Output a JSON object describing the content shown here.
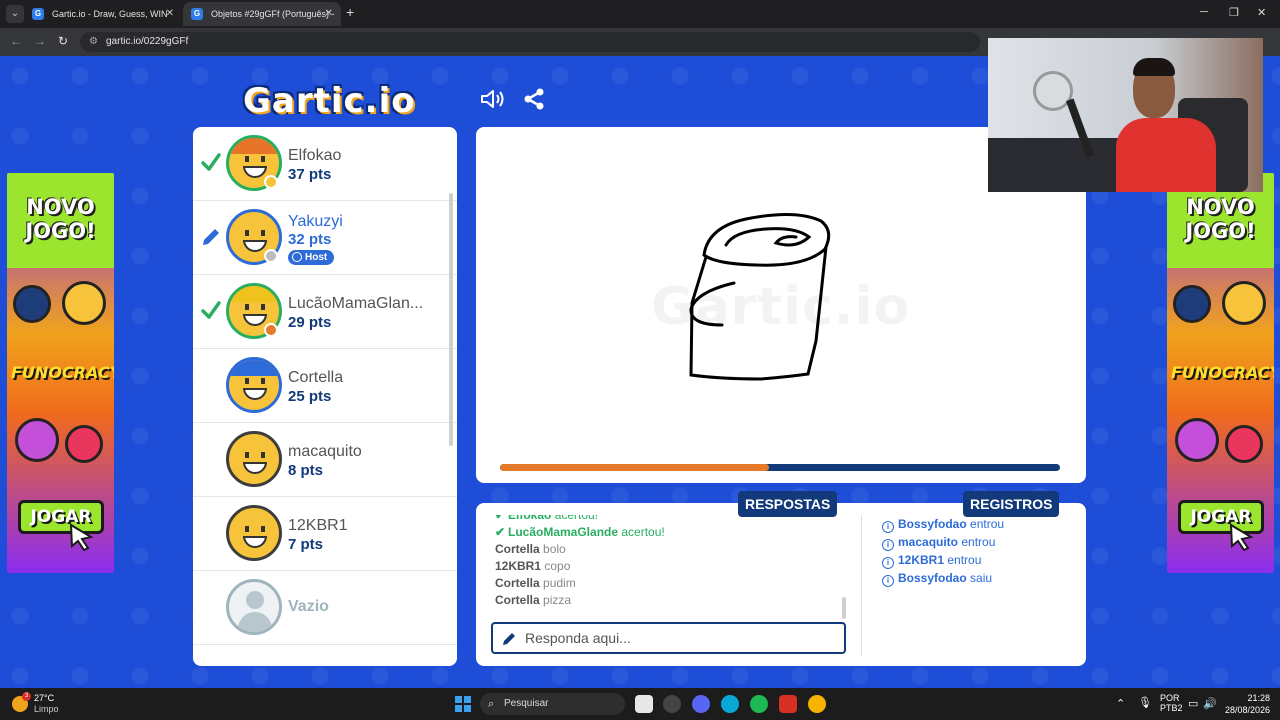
{
  "browser": {
    "tabs": [
      {
        "title": "Gartic.io - Draw, Guess, WIN",
        "favicon": "G"
      },
      {
        "title": "Objetos #29gGFf (Português) -",
        "favicon": "G"
      }
    ],
    "url": "gartic.io/0229gGFf"
  },
  "game": {
    "logo": "Gartic.io",
    "watermark": "Gartic.io",
    "progress": 0.48,
    "players": [
      {
        "name": "Elfokao",
        "points": "37 pts",
        "status": "guessed",
        "dot_color": "#f6c33b",
        "hair_color": "#e8742a",
        "ring": "green"
      },
      {
        "name": "Yakuzyi",
        "points": "32 pts",
        "status": "drawing",
        "host_label": "Host",
        "dot_color": "#bdbdbd",
        "hair_color": "",
        "ring": "blue"
      },
      {
        "name": "LucãoMamaGlan...",
        "points": "29 pts",
        "status": "guessed",
        "dot_color": "#e57a2a",
        "hair_color": "#f0c21c",
        "ring": "green"
      },
      {
        "name": "Cortella",
        "points": "25 pts",
        "status": "none",
        "dot_color": "",
        "hair_color": "#2d6bd8",
        "ring": "blue"
      },
      {
        "name": "macaquito",
        "points": "8 pts",
        "status": "none",
        "dot_color": "",
        "hair_color": "",
        "ring": "dark"
      },
      {
        "name": "12KBR1",
        "points": "7 pts",
        "status": "none",
        "dot_color": "",
        "hair_color": "",
        "ring": "dark"
      },
      {
        "name": "Vazio",
        "points": "",
        "status": "empty",
        "dot_color": "",
        "hair_color": "",
        "ring": "empty"
      }
    ],
    "answers_title": "RESPOSTAS",
    "logs_title": "REGISTROS",
    "answers": [
      {
        "who": "Elfokao",
        "what": "acertou!",
        "hit": true
      },
      {
        "who": "LucãoMamaGlande",
        "what": "acertou!",
        "hit": true
      },
      {
        "who": "Cortella",
        "what": "bolo",
        "hit": false
      },
      {
        "who": "12KBR1",
        "what": "copo",
        "hit": false
      },
      {
        "who": "Cortella",
        "what": "pudim",
        "hit": false
      },
      {
        "who": "Cortella",
        "what": "pizza",
        "hit": false
      }
    ],
    "answer_placeholder": "Responda aqui...",
    "logs": [
      {
        "who": "Bossyfodao",
        "what": "entrou"
      },
      {
        "who": "macaquito",
        "what": "entrou"
      },
      {
        "who": "12KBR1",
        "what": "entrou"
      },
      {
        "who": "Bossyfodao",
        "what": "saiu"
      }
    ]
  },
  "ads": {
    "title_line1": "NOVO",
    "title_line2": "JOGO!",
    "brand": "FUNOCRACY",
    "button": "JOGAR"
  },
  "taskbar": {
    "weather_temp": "27°C",
    "weather_desc": "Limpo",
    "weather_badge": "3",
    "search": "Pesquisar",
    "lang_line1": "POR",
    "lang_line2": "PTB2",
    "time": "21:28",
    "date": "28/08/2026"
  }
}
